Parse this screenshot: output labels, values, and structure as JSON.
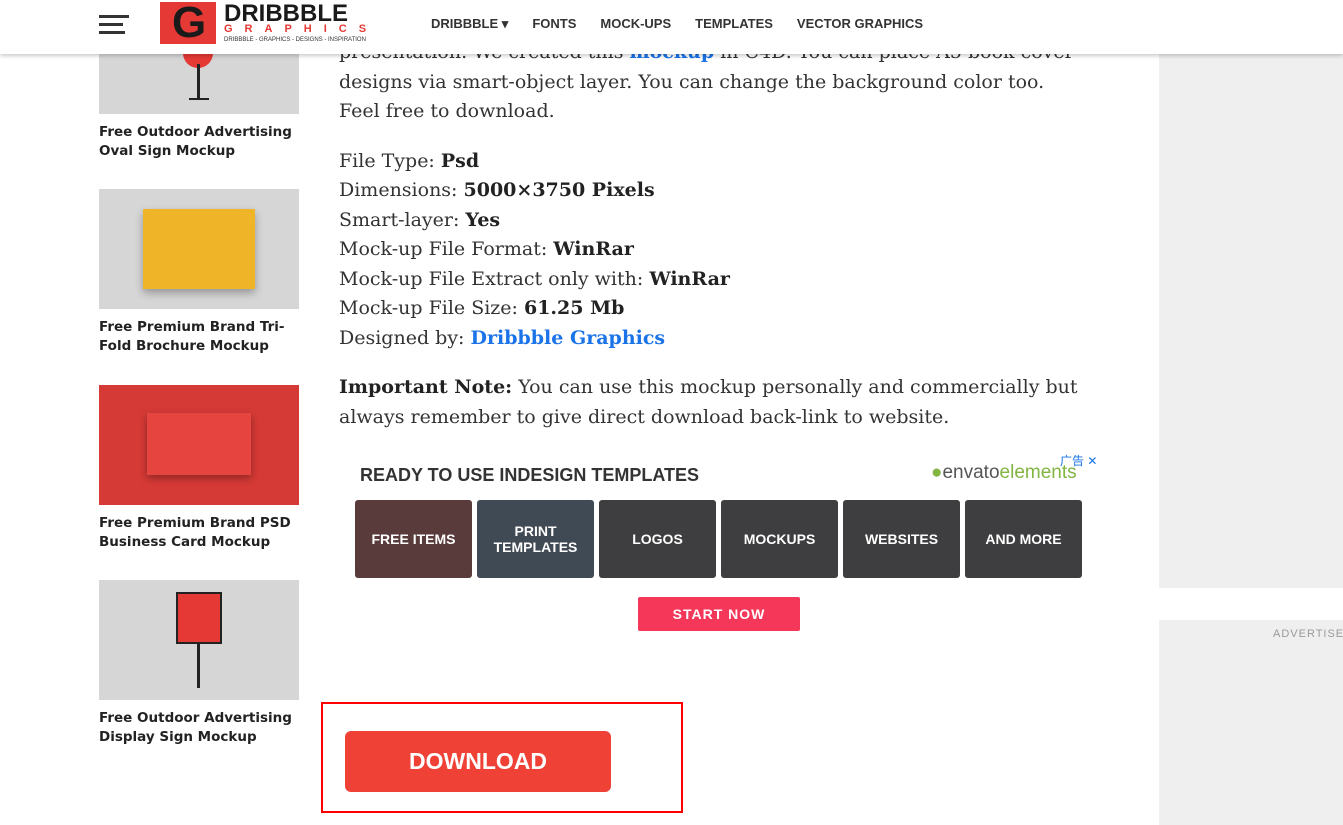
{
  "header": {
    "logo": {
      "mark": "G",
      "line1": "DRIBBBLE",
      "line2": "GRAPHICS",
      "tagline": "DRIBBBLE - GRAPHICS - DESIGNS - INSPIRATION"
    },
    "nav": [
      "DRIBBBLE ▾",
      "FONTS",
      "MOCK-UPS",
      "TEMPLATES",
      "VECTOR GRAPHICS"
    ]
  },
  "sidebar": [
    {
      "title": "Free Outdoor Advertising Oval Sign Mockup"
    },
    {
      "title": "Free Premium Brand Tri-Fold Brochure Mockup"
    },
    {
      "title": "Free Premium Brand PSD Business Card Mockup"
    },
    {
      "title": "Free Outdoor Advertising Display Sign Mockup"
    }
  ],
  "article": {
    "intro_pre": "presentation. We created this ",
    "intro_link": "mockup",
    "intro_post": " in C4D. You can place A5 book cover designs via smart-object layer. You can change the background color too. Feel free to download.",
    "specs": [
      {
        "label": "File Type: ",
        "value": "Psd"
      },
      {
        "label": "Dimensions: ",
        "value": "5000×3750 Pixels"
      },
      {
        "label": "Smart-layer: ",
        "value": "Yes"
      },
      {
        "label": "Mock-up File Format: ",
        "value": "WinRar"
      },
      {
        "label": "Mock-up File Extract only with: ",
        "value": "WinRar"
      },
      {
        "label": "Mock-up File Size: ",
        "value": "61.25 Mb"
      }
    ],
    "designed_label": "Designed by: ",
    "designed_link": "Dribbble Graphics",
    "note_label": "Important Note:",
    "note_text": " You can use this mockup personally and commercially but always remember to give direct download back-link to website."
  },
  "ad": {
    "headline": "READY TO USE INDESIGN TEMPLATES",
    "brand_a": "envato",
    "brand_b": "elements",
    "adchoice": "广告 ✕",
    "tiles": [
      "FREE ITEMS",
      "PRINT TEMPLATES",
      "LOGOS",
      "MOCKUPS",
      "WEBSITES",
      "AND MORE"
    ],
    "cta": "START NOW"
  },
  "download": "DOWNLOAD",
  "right": {
    "advertise": "ADVERTISE"
  }
}
